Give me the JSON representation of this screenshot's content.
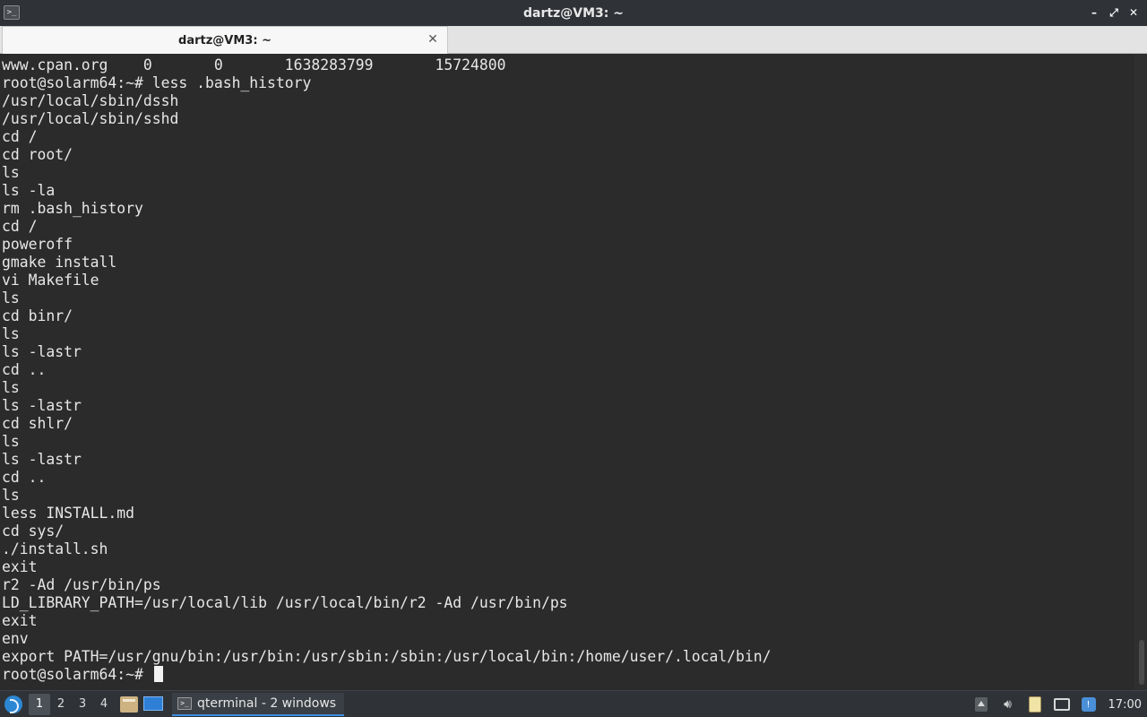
{
  "window": {
    "title": "dartz@VM3: ~",
    "app_icon": "terminal-icon",
    "controls": {
      "minimize": "–",
      "restore": "⤢",
      "close": "✕"
    }
  },
  "tabs": [
    {
      "label": "dartz@VM3: ~",
      "close": "✕"
    }
  ],
  "terminal": {
    "lines": [
      "www.cpan.org    0       0       1638283799       15724800",
      "root@solarm64:~# less .bash_history",
      "/usr/local/sbin/dssh",
      "/usr/local/sbin/sshd",
      "cd /",
      "cd root/",
      "ls",
      "ls -la",
      "rm .bash_history",
      "cd /",
      "poweroff",
      "gmake install",
      "vi Makefile",
      "ls",
      "cd binr/",
      "ls",
      "ls -lastr",
      "cd ..",
      "ls",
      "ls -lastr",
      "cd shlr/",
      "ls",
      "ls -lastr",
      "cd ..",
      "ls",
      "less INSTALL.md",
      "cd sys/",
      "./install.sh",
      "exit",
      "r2 -Ad /usr/bin/ps",
      "LD_LIBRARY_PATH=/usr/local/lib /usr/local/bin/r2 -Ad /usr/bin/ps",
      "exit",
      "env",
      "export PATH=/usr/gnu/bin:/usr/bin:/usr/sbin:/sbin:/usr/local/bin:/home/user/.local/bin/"
    ],
    "prompt": "root@solarm64:~# "
  },
  "taskbar": {
    "desktops": [
      "1",
      "2",
      "3",
      "4"
    ],
    "active_desktop": "1",
    "task_label": "qterminal - 2 windows",
    "clock": "17:00"
  },
  "colors": {
    "terminal_bg": "#2b2b2b",
    "terminal_fg": "#e7e7e7",
    "titlebar_bg": "#2f3237",
    "taskbar_bg": "#2f3337",
    "accent": "#3d8ee0"
  }
}
